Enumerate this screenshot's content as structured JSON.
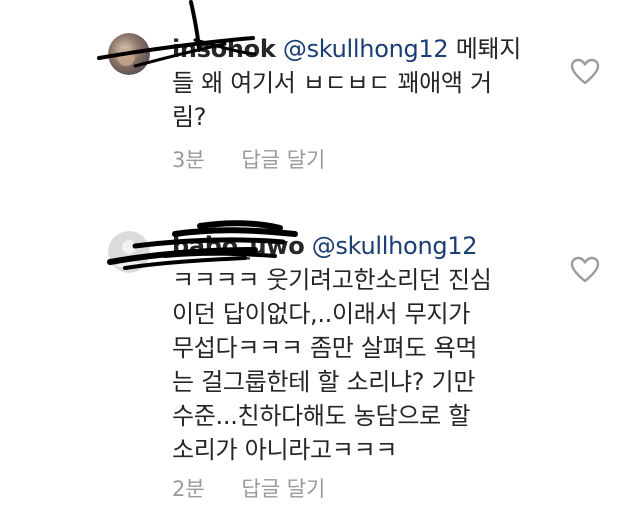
{
  "comments": [
    {
      "username": "insohok",
      "mention": "@skullhong12",
      "line1_rest": " 메퇘지",
      "line2": "들 왜 여기서 ㅂㄷㅂㄷ 꽤애액 거",
      "line3": "림?",
      "time": "3분",
      "reply_label": "답글 달기"
    },
    {
      "username": "babo_uwo",
      "mention": "@skullhong12",
      "lines": [
        "ㅋㅋㅋㅋ 웃기려고한소리던 진심",
        "이던 답이없다,..이래서 무지가",
        "무섭다ㅋㅋㅋ 좀만 살펴도 욕먹",
        "는 걸그룹한테 할 소리냐? 기만",
        "수준...친하다해도 농담으로 할",
        "소리가 아니라고ㅋㅋㅋ"
      ],
      "time": "2분",
      "reply_label": "답글 달기"
    }
  ],
  "icons": {
    "like": "heart-outline-icon",
    "avatar": "profile-avatar"
  },
  "colors": {
    "mention": "#1a3d74",
    "meta": "#9a9a9a",
    "heart_stroke": "#9b9b9b"
  }
}
